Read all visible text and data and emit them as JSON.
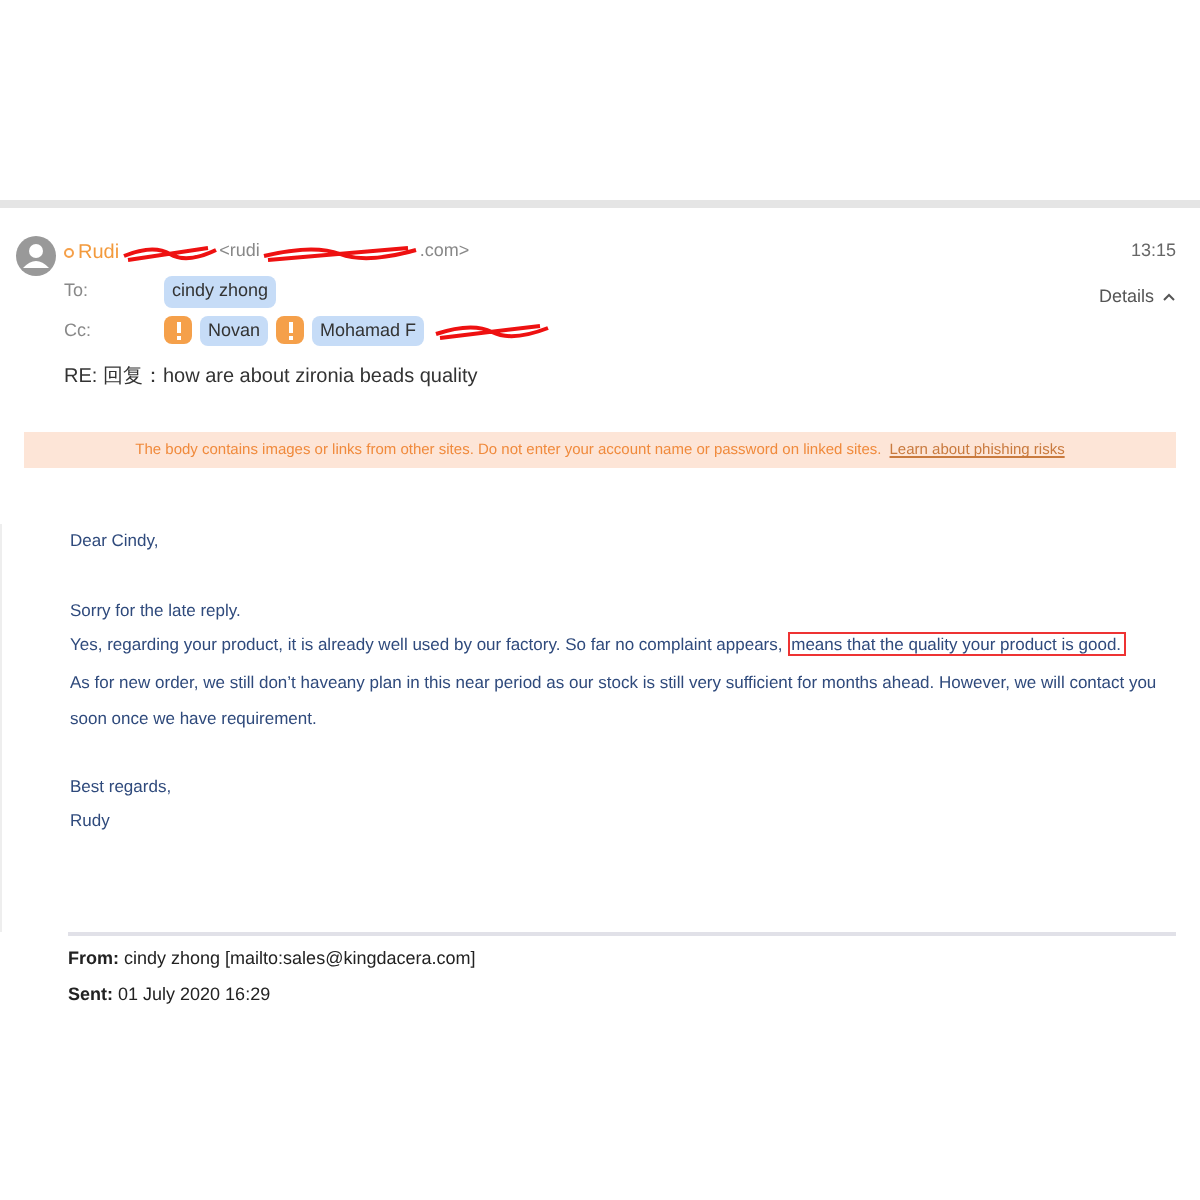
{
  "header": {
    "sender_name": "Rudi",
    "sender_address_start": "<rudi",
    "sender_address_end": ".com>",
    "time": "13:15",
    "details": "Details",
    "to_label": "To:",
    "to": [
      {
        "name": "cindy zhong",
        "warning": false
      }
    ],
    "cc_label": "Cc:",
    "cc": [
      {
        "name": "Novan",
        "warning": true
      },
      {
        "name": "Mohamad F",
        "warning": true
      }
    ],
    "subject": "RE: 回复：how are about zironia beads quality"
  },
  "warning_bar": {
    "text": "The body contains images or links from other sites. Do not enter your account name or password on linked sites.",
    "link": "Learn about phishing risks"
  },
  "body": {
    "greeting": "Dear Cindy,",
    "paragraphs": [
      "Sorry for the late reply.",
      "Yes, regarding your product, it is already well used by our factory. So far no complaint appears,",
      "As for new order, we still don’t haveany plan in this near period as our stock is still very sufficient for months ahead. However, we will contact you soon once we have requirement."
    ],
    "highlighted": "means that the quality your product is good.",
    "closing": "Best regards,",
    "signature": "Rudy"
  },
  "quoted": {
    "from_label": "From:",
    "from": "cindy zhong [mailto:sales@kingdacera.com]",
    "sent_label": "Sent:",
    "sent": "01 July 2020 16:29"
  }
}
